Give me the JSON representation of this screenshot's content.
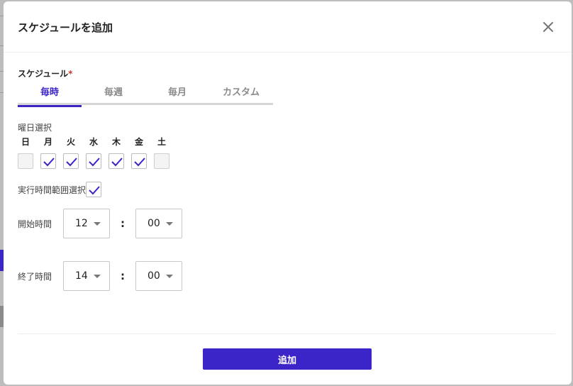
{
  "modal": {
    "title": "スケジュールを追加",
    "close_icon": "close-icon"
  },
  "schedule": {
    "label": "スケジュール",
    "required_mark": "*",
    "tabs": [
      {
        "label": "毎時",
        "active": true
      },
      {
        "label": "毎週",
        "active": false
      },
      {
        "label": "毎月",
        "active": false
      },
      {
        "label": "カスタム",
        "active": false
      }
    ]
  },
  "weekday": {
    "label": "曜日選択",
    "days": [
      {
        "label": "日",
        "checked": false
      },
      {
        "label": "月",
        "checked": true
      },
      {
        "label": "火",
        "checked": true
      },
      {
        "label": "水",
        "checked": true
      },
      {
        "label": "木",
        "checked": true
      },
      {
        "label": "金",
        "checked": true
      },
      {
        "label": "土",
        "checked": false
      }
    ]
  },
  "time_range": {
    "label": "実行時間範囲選択",
    "checked": true,
    "start": {
      "label": "開始時間",
      "hour": "12",
      "separator": ":",
      "minute": "00"
    },
    "end": {
      "label": "終了時間",
      "hour": "14",
      "separator": ":",
      "minute": "00"
    }
  },
  "submit": {
    "label": "追加"
  },
  "colors": {
    "accent": "#3b24c8",
    "required": "#c0392b"
  }
}
